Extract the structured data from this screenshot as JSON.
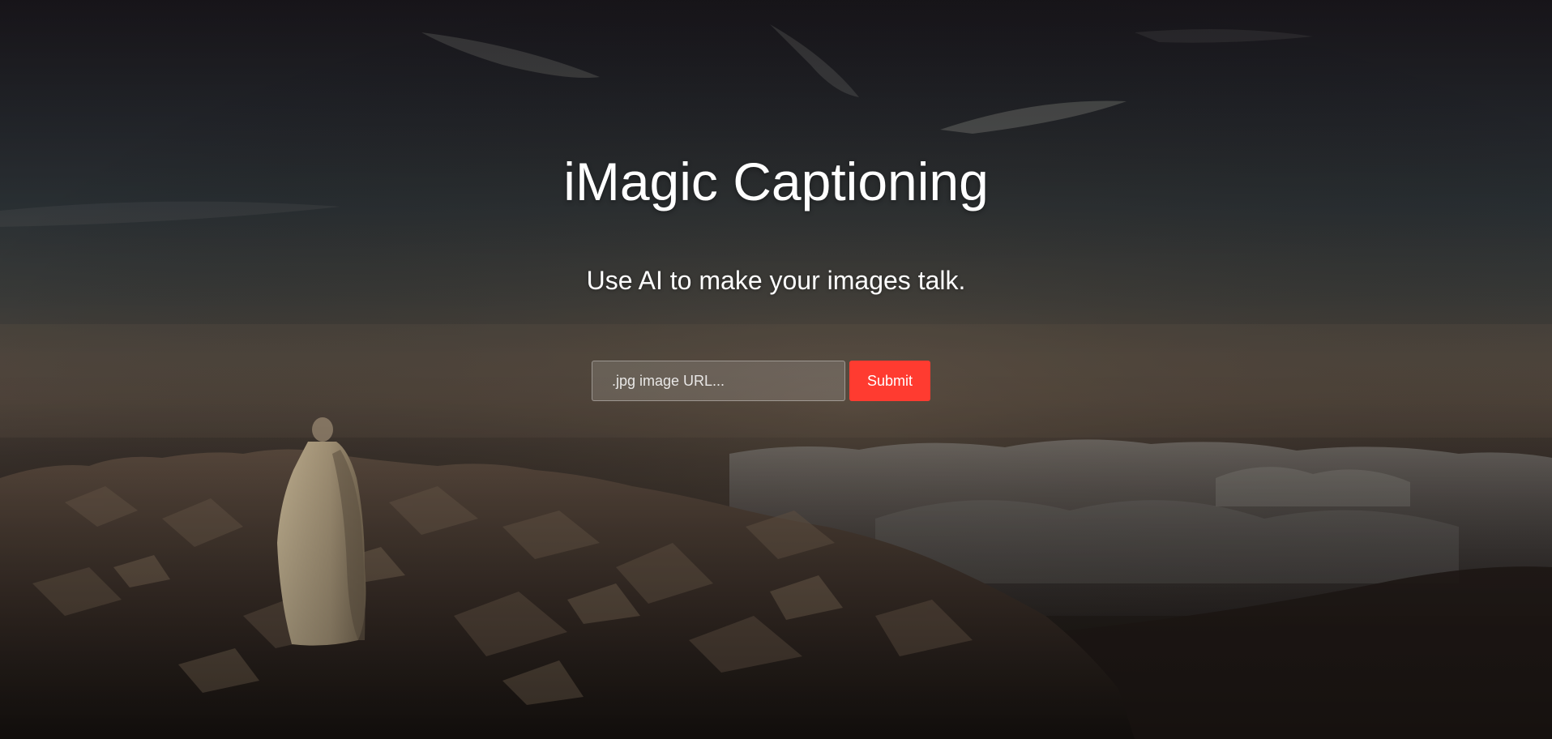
{
  "hero": {
    "title": "iMagic Captioning",
    "subtitle": "Use AI to make your images talk."
  },
  "form": {
    "url_input": {
      "value": "",
      "placeholder": ".jpg image URL..."
    },
    "submit_label": "Submit"
  },
  "colors": {
    "accent": "#ff3b30",
    "text": "#ffffff"
  }
}
